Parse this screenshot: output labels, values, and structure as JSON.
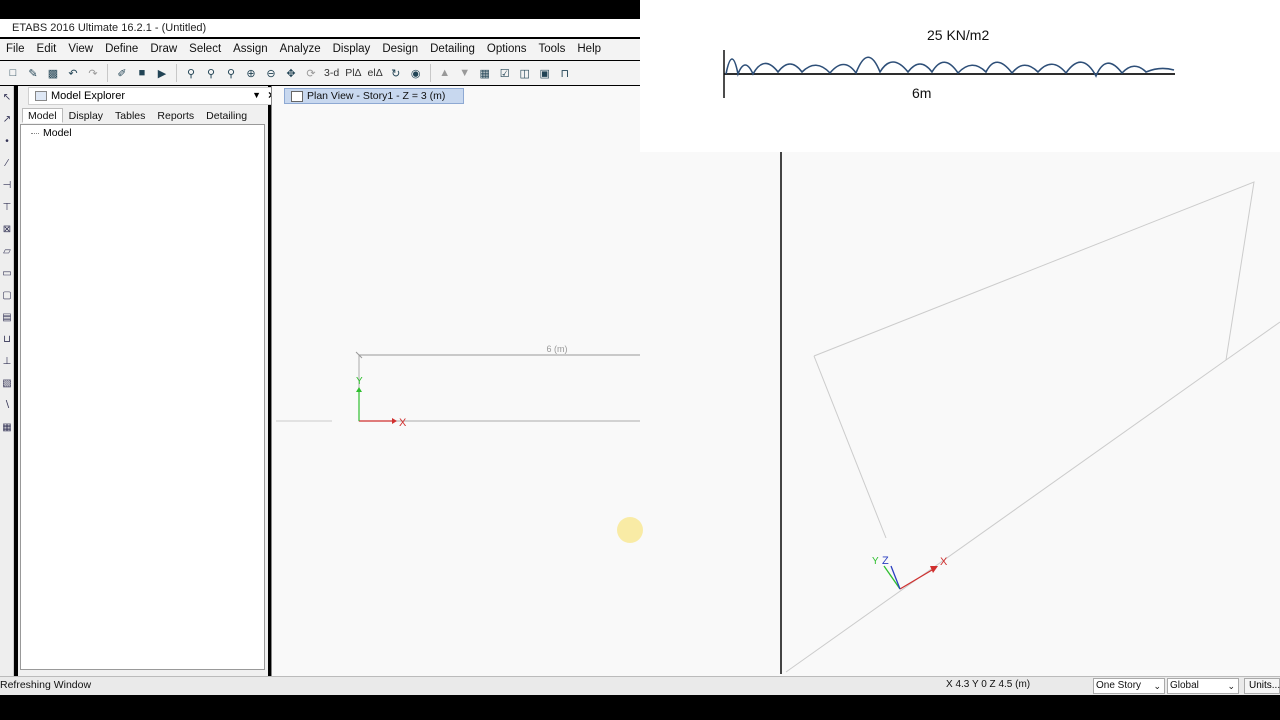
{
  "window": {
    "title": "ETABS 2016 Ultimate 16.2.1 - (Untitled)"
  },
  "menu": [
    "File",
    "Edit",
    "View",
    "Define",
    "Draw",
    "Select",
    "Assign",
    "Analyze",
    "Display",
    "Design",
    "Detailing",
    "Options",
    "Tools",
    "Help"
  ],
  "toolbar": {
    "view3d_label": "3-d",
    "plan_label": "PlΔ",
    "elev_label": "elΔ"
  },
  "explorer": {
    "title": "Model Explorer",
    "tabs": [
      "Model",
      "Display",
      "Tables",
      "Reports",
      "Detailing"
    ],
    "active_tab": "Model",
    "tree_root": "Model"
  },
  "plan_view": {
    "tab_label": "Plan View - Story1 - Z = 3 (m)",
    "dimension_label": "6 (m)",
    "axis_x": "X",
    "axis_y": "Y"
  },
  "view3d": {
    "axis_x": "X",
    "axis_y": "Y",
    "axis_z": "Z"
  },
  "note": {
    "load": "25 KN/m2",
    "span": "6m"
  },
  "status": {
    "text": "Refreshing Window",
    "coords": "X 4.3  Y 0  Z 4.5 (m)",
    "story_option": "One Story",
    "coord_system": "Global",
    "units_button": "Units..."
  },
  "colors": {
    "axis_x": "#d0302f",
    "axis_y": "#2fbf2f",
    "axis_z": "#2a3fc0",
    "tab_active": "#c8d8ef"
  }
}
